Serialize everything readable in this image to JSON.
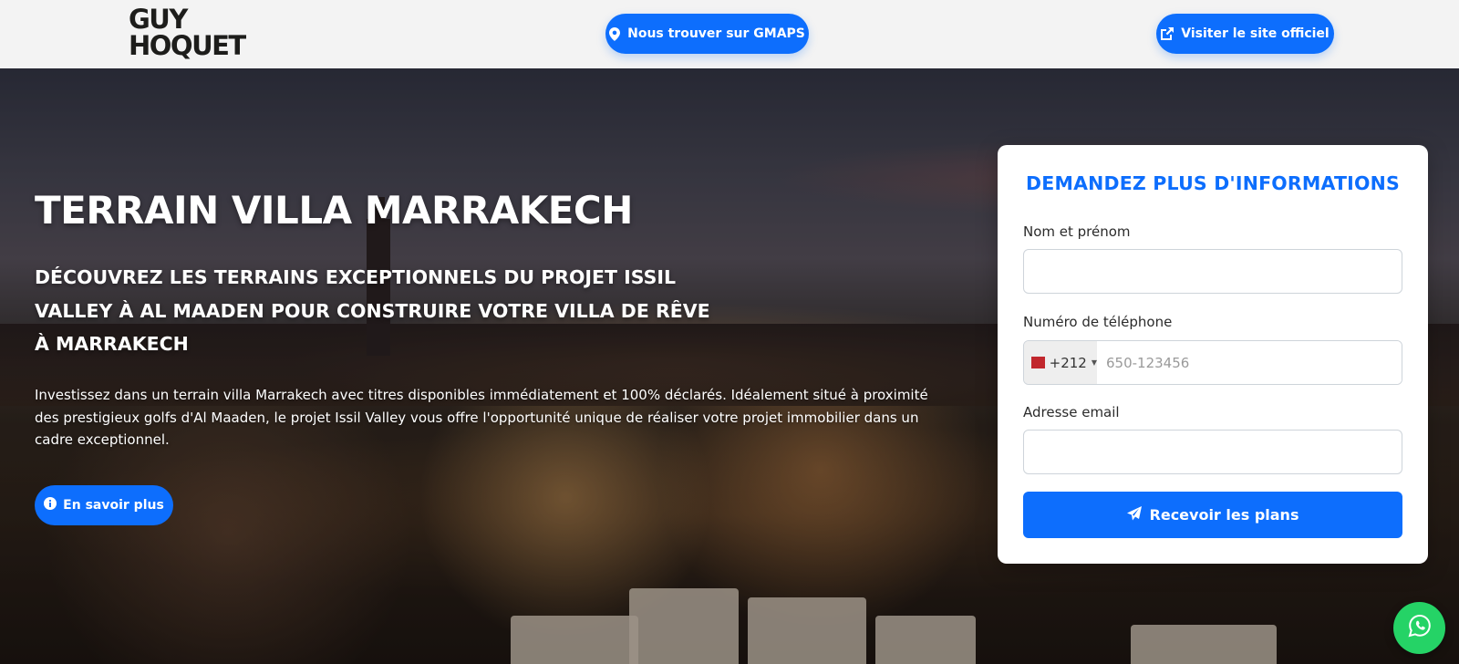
{
  "header": {
    "logo_line1": "GUY",
    "logo_line2": "HOQUET",
    "gmaps_label": "Nous trouver sur GMAPS",
    "gmaps_icon": "map-pin-icon",
    "site_label": "Visiter le site officiel",
    "site_icon": "external-link-icon"
  },
  "hero": {
    "title": "TERRAIN VILLA MARRAKECH",
    "subtitle": "Découvrez les terrains exceptionnels du projet Issil Valley à Al Maaden pour construire votre villa de rêve à Marrakech",
    "text": "Investissez dans un terrain villa Marrakech avec titres disponibles immédiatement et 100% déclarés. Idéalement situé à proximité des prestigieux golfs d'Al Maaden, le projet Issil Valley vous offre l'opportunité unique de réaliser votre projet immobilier dans un cadre exceptionnel.",
    "more_label": "En savoir plus",
    "more_icon": "info-circle-icon"
  },
  "form": {
    "title": "DEMANDEZ PLUS D'INFORMATIONS",
    "name_label": "Nom et prénom",
    "name_value": "",
    "phone_label": "Numéro de téléphone",
    "phone_prefix": "+212",
    "phone_placeholder": "650-123456",
    "phone_flag": "morocco-flag-icon",
    "email_label": "Adresse email",
    "email_value": "",
    "submit_label": "Recevoir les plans",
    "submit_icon": "paper-plane-icon"
  },
  "floating": {
    "whatsapp_icon": "whatsapp-icon"
  },
  "colors": {
    "primary": "#0d6efd",
    "whatsapp": "#25d366",
    "header_bg": "#f3f3f3"
  }
}
